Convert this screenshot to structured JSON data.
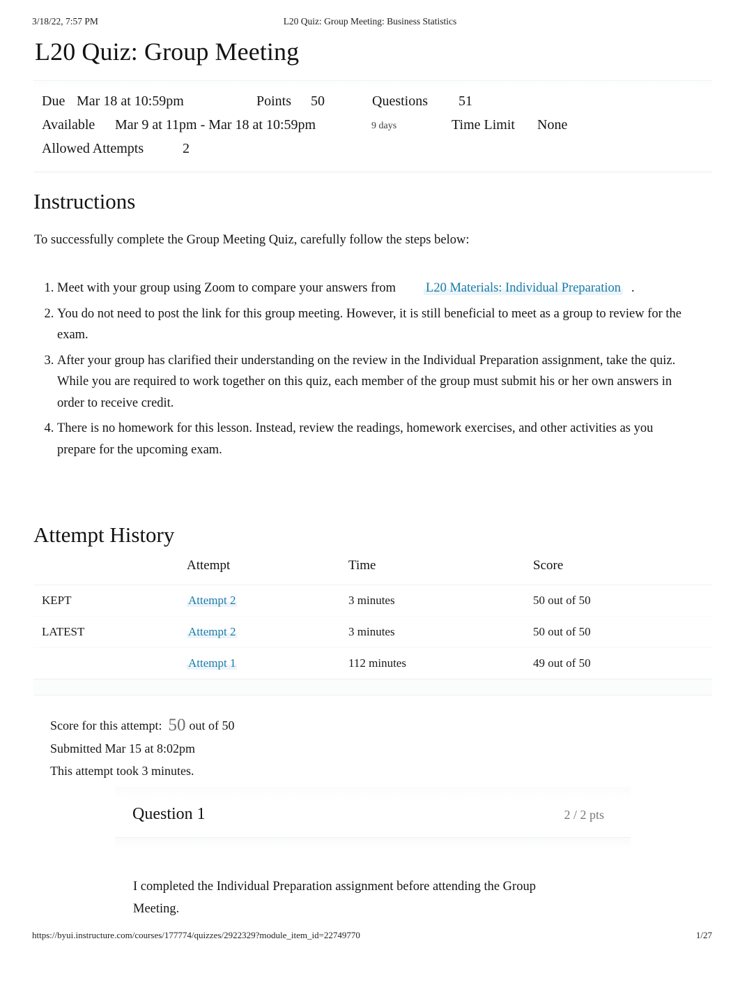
{
  "print_header": {
    "date": "3/18/22, 7:57 PM",
    "title": "L20 Quiz: Group Meeting: Business Statistics"
  },
  "quiz": {
    "title": "L20 Quiz: Group Meeting",
    "info": {
      "due_label": "Due",
      "due_value": "Mar 18 at 10:59pm",
      "points_label": "Points",
      "points_value": "50",
      "questions_label": "Questions",
      "questions_value": "51",
      "available_label": "Available",
      "available_value": "Mar 9 at 11pm - Mar 18 at 10:59pm",
      "available_duration": "9 days",
      "time_limit_label": "Time Limit",
      "time_limit_value": "None",
      "allowed_attempts_label": "Allowed Attempts",
      "allowed_attempts_value": "2"
    }
  },
  "instructions": {
    "heading": "Instructions",
    "intro": "To successfully complete the Group Meeting Quiz, carefully follow the steps below:",
    "steps": [
      {
        "before": "Meet with your group using Zoom to compare your answers from",
        "link": "L20 Materials: Individual Preparation",
        "after": "."
      },
      {
        "text": "You do not need to post the link for this group meeting. However, it is still beneficial to meet as a group to review for the exam."
      },
      {
        "text": "After your group has clarified their understanding on the review in the Individual Preparation assignment, take the quiz. While you are required to work together on this quiz, each member of the group must submit his or her own answers in order to receive credit."
      },
      {
        "text": "There is no homework for this lesson. Instead, review the readings, homework exercises, and other activities as you prepare for the upcoming exam."
      }
    ]
  },
  "attempt_history": {
    "heading": "Attempt History",
    "columns": [
      "",
      "Attempt",
      "Time",
      "Score"
    ],
    "rows": [
      {
        "tag": "KEPT",
        "attempt": "Attempt 2",
        "time": "3 minutes",
        "score": "50 out of 50"
      },
      {
        "tag": "LATEST",
        "attempt": "Attempt 2",
        "time": "3 minutes",
        "score": "50 out of 50"
      },
      {
        "tag": "",
        "attempt": "Attempt 1",
        "time": "112 minutes",
        "score": "49 out of 50"
      }
    ]
  },
  "score_summary": {
    "score_label": "Score for this attempt:",
    "score_value": "50",
    "score_out_of": "out of 50",
    "submitted": "Submitted Mar 15 at 8:02pm",
    "duration": "This attempt took 3 minutes."
  },
  "question": {
    "name": "Question 1",
    "points": "2 / 2 pts",
    "text": " I completed the Individual Preparation assignment before attending the Group Meeting."
  },
  "print_footer": {
    "url": "https://byui.instructure.com/courses/177774/quizzes/2922329?module_item_id=22749770",
    "page": "1/27"
  },
  "colors": {
    "link": "#1a7ba8",
    "text": "#1a1a1a",
    "muted": "#77797c"
  }
}
